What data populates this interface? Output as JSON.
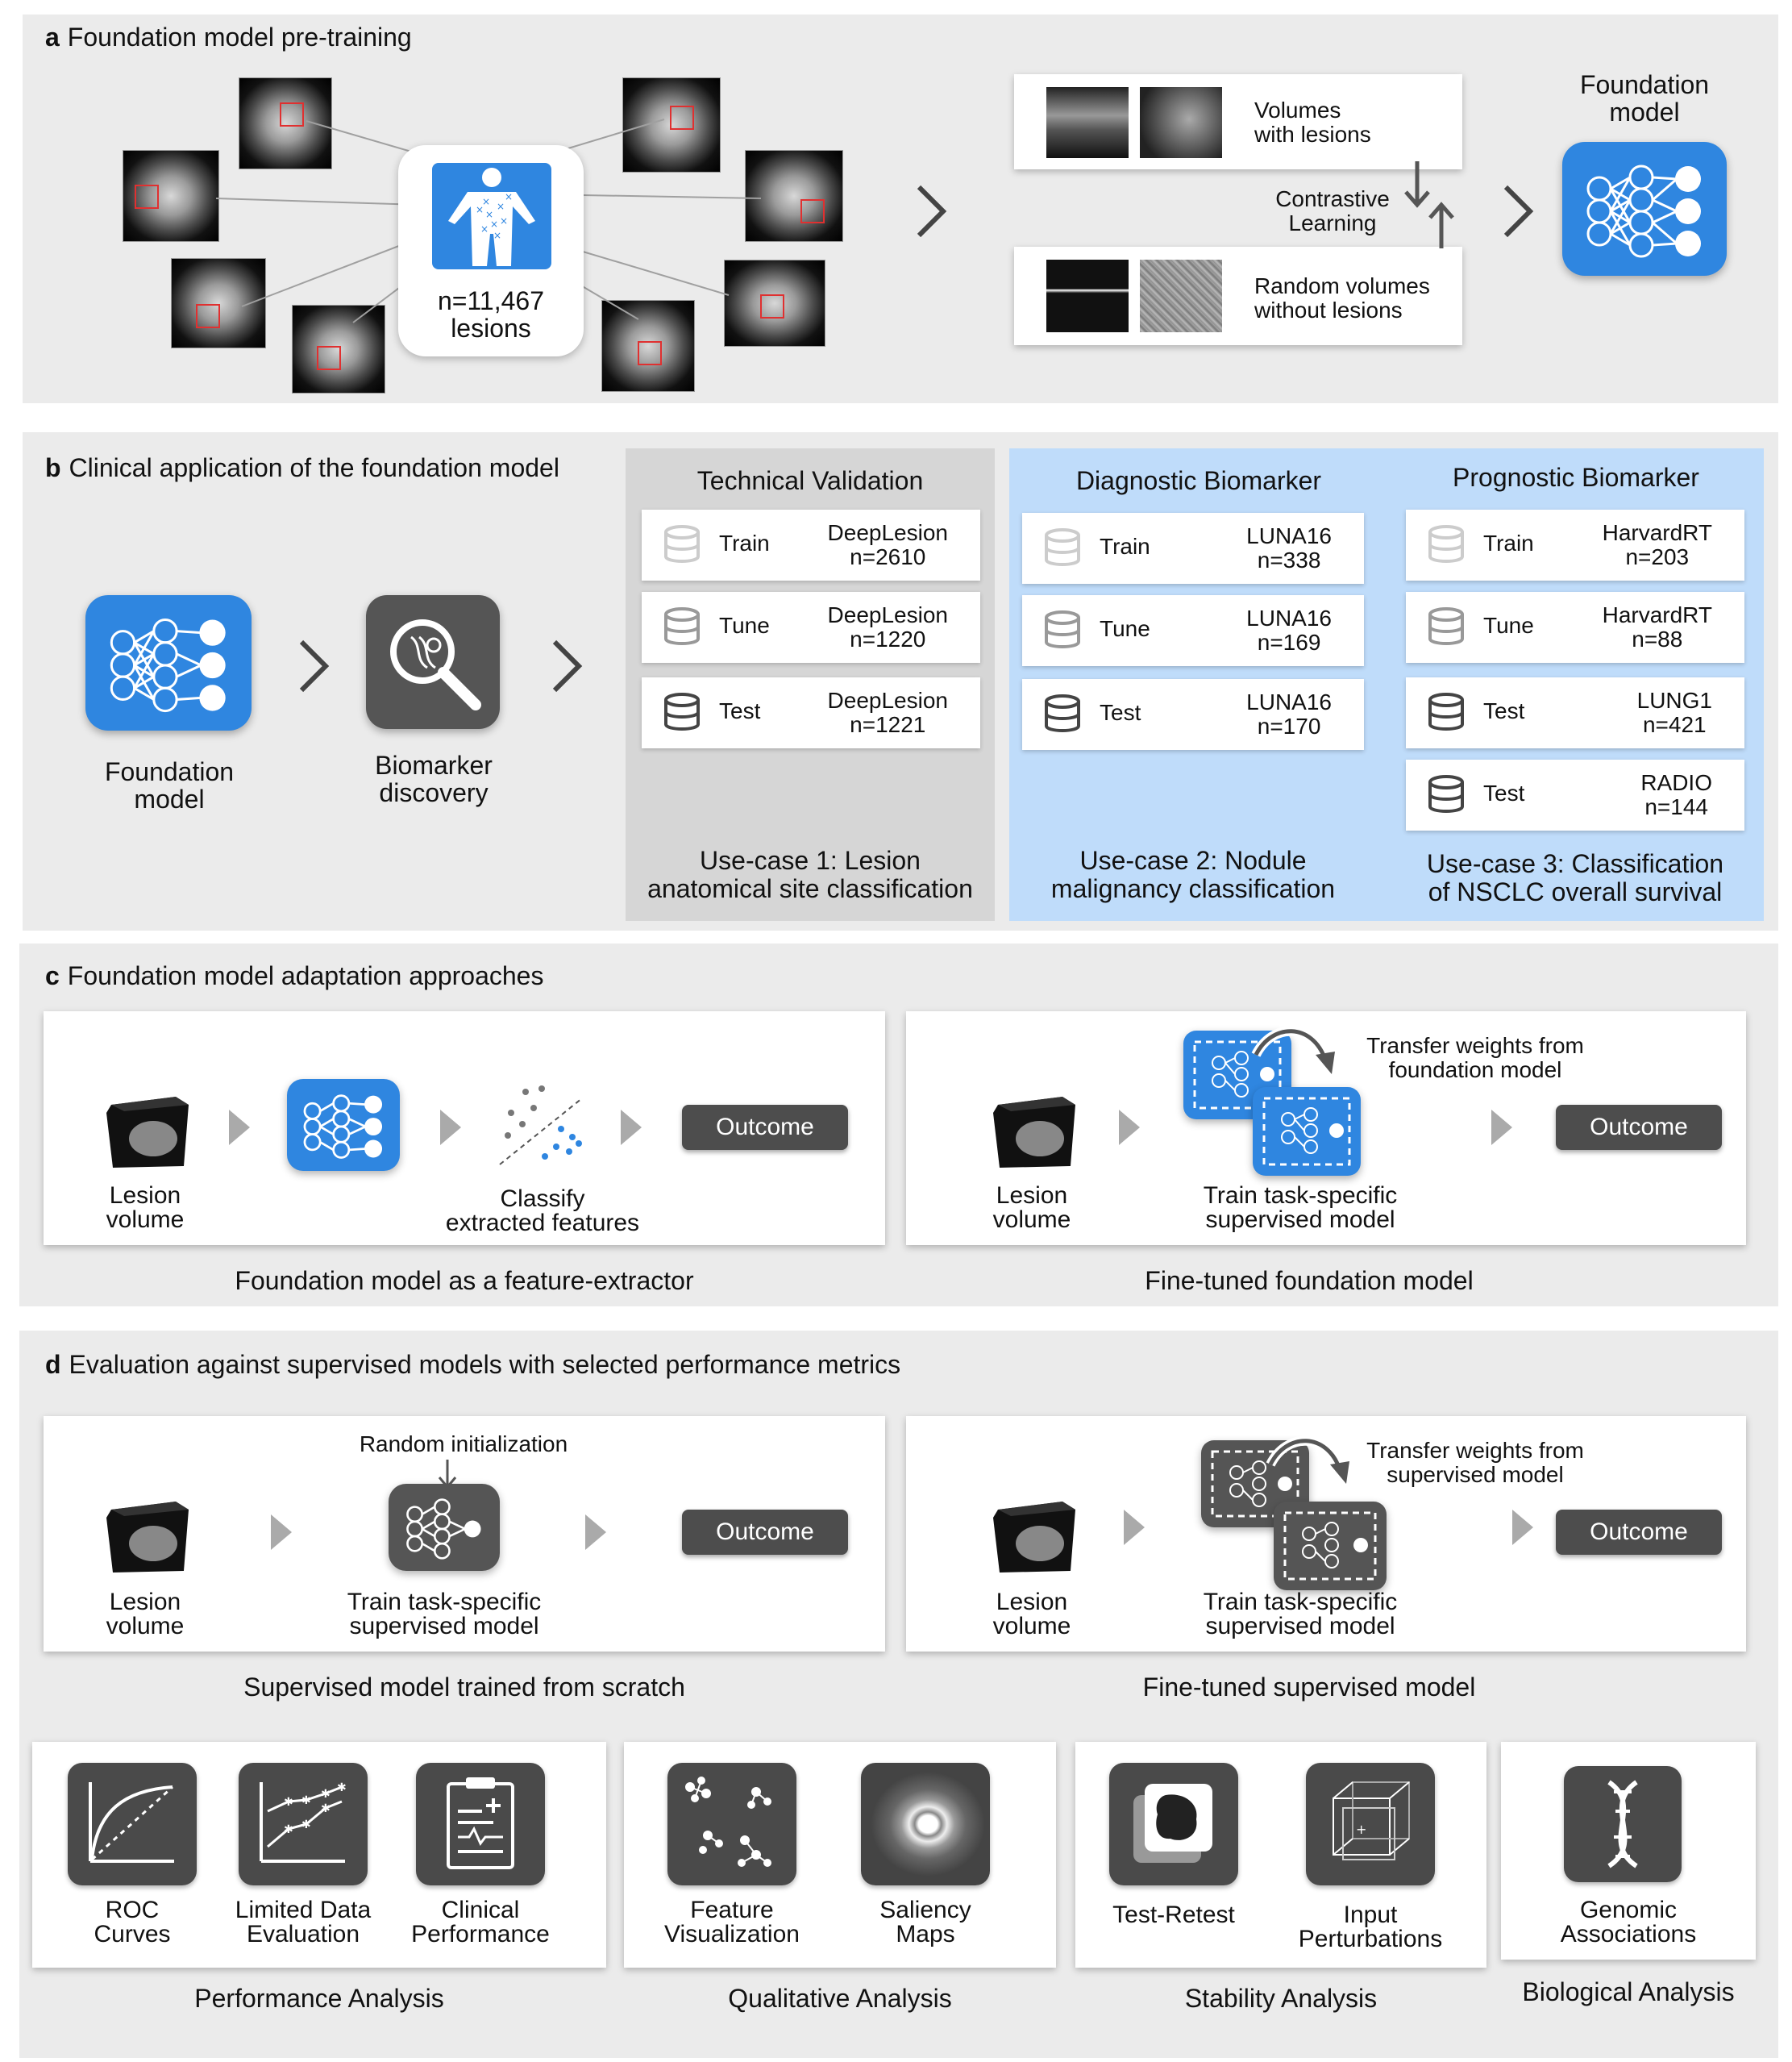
{
  "panel_a": {
    "letter": "a",
    "title": "Foundation model pre-training",
    "lesions_count": "n=11,467",
    "lesions_word": "lesions",
    "volumes_with": "Volumes\nwith lesions",
    "contrastive": "Contrastive\nLearning",
    "random_volumes": "Random volumes\nwithout lesions",
    "foundation_model": "Foundation\nmodel"
  },
  "panel_b": {
    "letter": "b",
    "title": "Clinical application of the foundation model",
    "foundation_model": "Foundation\nmodel",
    "biomarker": "Biomarker\ndiscovery",
    "columns": [
      {
        "header": "Technical Validation",
        "rows": [
          {
            "split": "Train",
            "dataset": "DeepLesion",
            "n": "n=2610"
          },
          {
            "split": "Tune",
            "dataset": "DeepLesion",
            "n": "n=1220"
          },
          {
            "split": "Test",
            "dataset": "DeepLesion",
            "n": "n=1221"
          }
        ],
        "usecase": "Use-case 1: Lesion\nanatomical site classification"
      },
      {
        "header": "Diagnostic Biomarker",
        "rows": [
          {
            "split": "Train",
            "dataset": "LUNA16",
            "n": "n=338"
          },
          {
            "split": "Tune",
            "dataset": "LUNA16",
            "n": "n=169"
          },
          {
            "split": "Test",
            "dataset": "LUNA16",
            "n": "n=170"
          }
        ],
        "usecase": "Use-case 2: Nodule\nmalignancy classification"
      },
      {
        "header": "Prognostic Biomarker",
        "rows": [
          {
            "split": "Train",
            "dataset": "HarvardRT",
            "n": "n=203"
          },
          {
            "split": "Tune",
            "dataset": "HarvardRT",
            "n": "n=88"
          },
          {
            "split": "Test",
            "dataset": "LUNG1",
            "n": "n=421"
          },
          {
            "split": "Test",
            "dataset": "RADIO",
            "n": "n=144"
          }
        ],
        "usecase": "Use-case 3: Classification\nof NSCLC overall survival"
      }
    ]
  },
  "panel_c": {
    "letter": "c",
    "title": "Foundation model adaptation approaches",
    "left": {
      "lesion_volume": "Lesion\nvolume",
      "classify": "Classify\nextracted features",
      "outcome": "Outcome",
      "caption": "Foundation model as a feature-extractor"
    },
    "right": {
      "lesion_volume": "Lesion\nvolume",
      "transfer": "Transfer weights from\nfoundation model",
      "train": "Train task-specific\nsupervised model",
      "outcome": "Outcome",
      "caption": "Fine-tuned foundation model"
    }
  },
  "panel_d": {
    "letter": "d",
    "title": "Evaluation against supervised models with selected performance metrics",
    "left": {
      "random_init": "Random initialization",
      "lesion_volume": "Lesion\nvolume",
      "train": "Train task-specific\nsupervised model",
      "outcome": "Outcome",
      "caption": "Supervised model trained from scratch"
    },
    "right": {
      "lesion_volume": "Lesion\nvolume",
      "transfer": "Transfer weights from\nsupervised model",
      "train": "Train task-specific\nsupervised model",
      "outcome": "Outcome",
      "caption": "Fine-tuned supervised model"
    },
    "analyses": [
      {
        "caption": "Performance Analysis",
        "items": [
          {
            "label": "ROC\nCurves",
            "icon": "roc-curve-icon"
          },
          {
            "label": "Limited Data\nEvaluation",
            "icon": "line-chart-icon"
          },
          {
            "label": "Clinical\nPerformance",
            "icon": "clipboard-icon"
          }
        ]
      },
      {
        "caption": "Qualitative Analysis",
        "items": [
          {
            "label": "Feature\nVisualization",
            "icon": "scatter-clusters-icon"
          },
          {
            "label": "Saliency\nMaps",
            "icon": "saliency-map-icon"
          }
        ]
      },
      {
        "caption": "Stability Analysis",
        "items": [
          {
            "label": "Test-Retest",
            "icon": "stacked-scans-icon"
          },
          {
            "label": "Input\nPerturbations",
            "icon": "wireframe-cube-icon"
          }
        ]
      },
      {
        "caption": "Biological Analysis",
        "items": [
          {
            "label": "Genomic\nAssociations",
            "icon": "dna-icon"
          }
        ]
      }
    ]
  },
  "colors": {
    "panel_bg": "#ebebeb",
    "blue": "#2f86e0",
    "light_blue_bg": "#bfdcfa",
    "gray_column": "#d6d6d6",
    "dark_icon": "#4a4a4a",
    "lesion_box": "#e03030"
  }
}
